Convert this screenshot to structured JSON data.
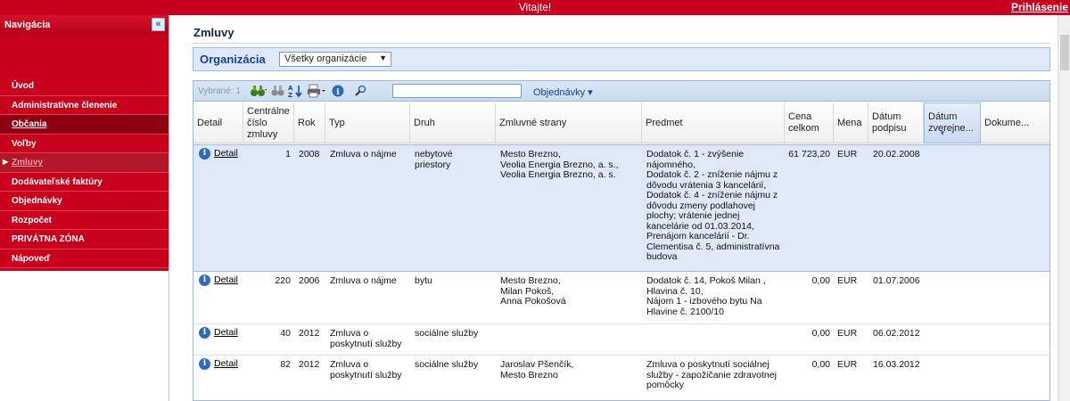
{
  "topbar": {
    "welcome": "Vitajte!",
    "login": "Prihlásenie"
  },
  "nav": {
    "title": "Navigácia",
    "collapse": "«",
    "items": [
      {
        "label": "Úvod"
      },
      {
        "label": "Administratívne členenie"
      },
      {
        "label": "Občania"
      },
      {
        "label": "Voľby"
      },
      {
        "label": "Zmluvy"
      },
      {
        "label": "Dodávateľské faktúry"
      },
      {
        "label": "Objednávky"
      },
      {
        "label": "Rozpočet"
      },
      {
        "label": "PRIVÁTNA ZÓNA"
      },
      {
        "label": "Nápoveď"
      }
    ]
  },
  "page": {
    "title": "Zmluvy"
  },
  "org": {
    "label": "Organizácia",
    "selected": "Všetky organizácie",
    "caret": "▼"
  },
  "toolbar": {
    "selected": "Vybrané: 1",
    "orders": "Objednávky ▾",
    "search_value": ""
  },
  "columns": {
    "detail": "Detail",
    "central": "Centrálne číslo zmluvy",
    "year": "Rok",
    "type": "Typ",
    "kind": "Druh",
    "parties": "Zmluvné strany",
    "subject": "Predmet",
    "price": "Cena celkom",
    "currency": "Mena",
    "signed": "Dátum podpisu",
    "published": "Dátum zverejne...",
    "docs": "Dokume..."
  },
  "rows": [
    {
      "detail": "Detail",
      "central": "1",
      "year": "2008",
      "type": "Zmluva o nájme",
      "kind": "nebytové priestory",
      "parties": [
        "Mesto Brezno,",
        "Veolia Energia Brezno, a. s.,",
        "Veolia Energia Brezno, a. s."
      ],
      "subject": [
        "Dodatok č. 1 - zvýšenie",
        "nájomného,",
        "Dodatok č. 2 - zníženie nájmu z",
        "dôvodu vrátenia 3 kancelárií,",
        "Dodatok č. 4 - zníženie nájmu z",
        "dôvodu zmeny podlahovej",
        "plochy; vrátenie jednej",
        "kancelárie od 01.03.2014,",
        "Prenájom kancelárií - Dr.",
        "Clementisa č. 5, administratívna",
        "budova"
      ],
      "price": "61 723,20",
      "currency": "EUR",
      "signed": "20.02.2008"
    },
    {
      "detail": "Detail",
      "central": "220",
      "year": "2006",
      "type": "Zmluva o nájme",
      "kind": "bytu",
      "parties": [
        "Mesto Brezno,",
        "Milan Pokoš,",
        "Anna Pokošová"
      ],
      "subject": [
        "Dodatok č. 14, Pokoš Milan ,",
        "Hlavina č. 10,",
        "Nájom 1 - izbového bytu Na",
        "Hlavine č. 2100/10"
      ],
      "price": "0,00",
      "currency": "EUR",
      "signed": "01.07.2006"
    },
    {
      "detail": "Detail",
      "central": "40",
      "year": "2012",
      "type": "Zmluva o poskytnutí služby",
      "kind": "sociálne služby",
      "parties": [],
      "subject": [],
      "price": "0,00",
      "currency": "EUR",
      "signed": "06.02.2012"
    },
    {
      "detail": "Detail",
      "central": "82",
      "year": "2012",
      "type": "Zmluva o poskytnutí služby",
      "kind": "sociálne služby",
      "parties": [
        "Jaroslav Pšenčík,",
        "Mesto Brezno"
      ],
      "subject": [
        "Zmluva o poskytnutí sociálnej",
        "služby - zapožičanie zdravotnej",
        "pomôcky"
      ],
      "price": "0,00",
      "currency": "EUR",
      "signed": "16.03.2012"
    }
  ]
}
